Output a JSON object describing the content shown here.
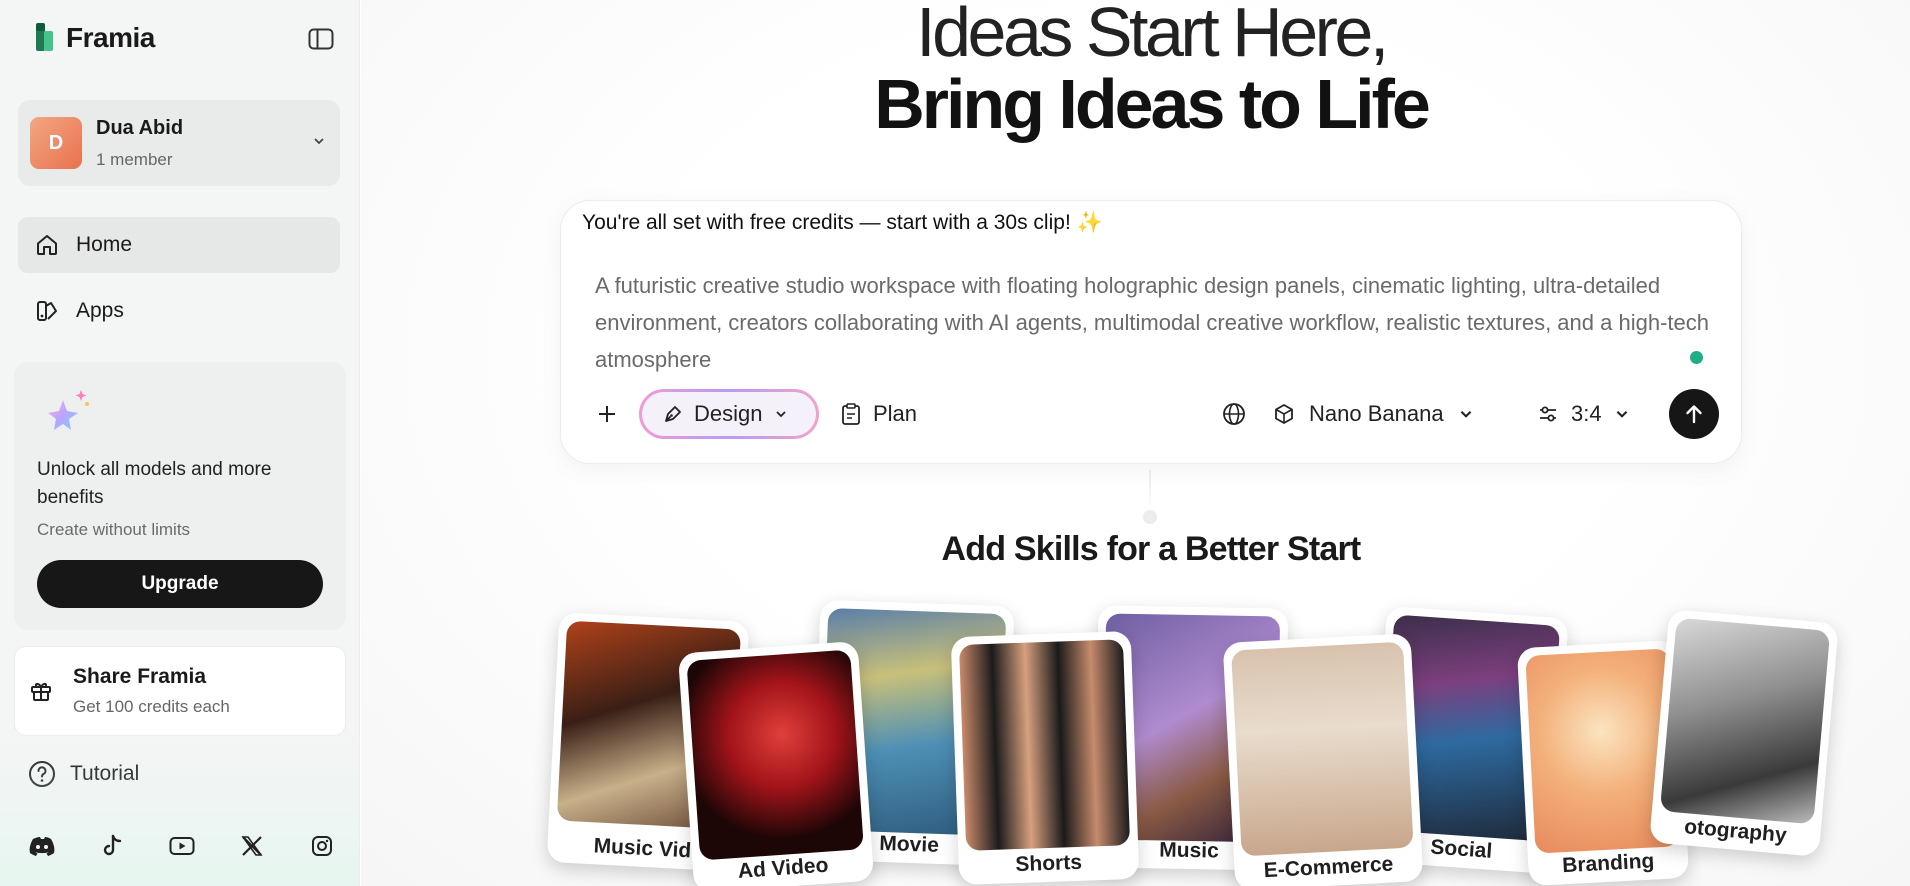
{
  "sidebar": {
    "brand": "Framia",
    "account": {
      "initial": "D",
      "name": "Dua Abid",
      "members": "1 member"
    },
    "nav": [
      {
        "label": "Home",
        "icon": "home-icon",
        "active": true
      },
      {
        "label": "Apps",
        "icon": "apps-icon",
        "active": false
      }
    ],
    "promo": {
      "icon": "sparkle-star-icon",
      "title": "Unlock all models and more benefits",
      "subtitle": "Create without limits",
      "button": "Upgrade"
    },
    "share": {
      "title": "Share Framia",
      "subtitle": "Get 100 credits each",
      "icon": "gift-icon"
    },
    "tutorial": {
      "label": "Tutorial",
      "icon": "help-circle-icon"
    },
    "socials": [
      "discord-icon",
      "tiktok-icon",
      "youtube-icon",
      "x-icon",
      "instagram-icon"
    ]
  },
  "hero": {
    "line1": "Ideas Start Here,",
    "line2": "Bring Ideas to Life"
  },
  "prompt": {
    "credits_message": "You're all set with free credits — start with a 30s clip! ✨",
    "text": "A futuristic creative studio workspace with floating holographic design panels, cinematic lighting, ultra-detailed environment, creators collaborating with AI agents, multimodal creative workflow, realistic textures, and a high-tech atmosphere",
    "toolbar": {
      "add": "+",
      "mode": "Design",
      "plan": "Plan",
      "model": "Nano Banana",
      "ratio": "3:4"
    }
  },
  "skills": {
    "title": "Add Skills for a Better Start",
    "cards": [
      {
        "label": "Music Vid"
      },
      {
        "label": "Ad Video"
      },
      {
        "label": "Movie"
      },
      {
        "label": "Shorts"
      },
      {
        "label": "Music"
      },
      {
        "label": "E-Commerce"
      },
      {
        "label": "Social"
      },
      {
        "label": "Branding"
      },
      {
        "label": "otography"
      }
    ]
  },
  "colors": {
    "accent_dark": "#161616",
    "online_dot": "#1fae86",
    "avatar_gradient": [
      "#f2a784",
      "#e9714f"
    ]
  }
}
